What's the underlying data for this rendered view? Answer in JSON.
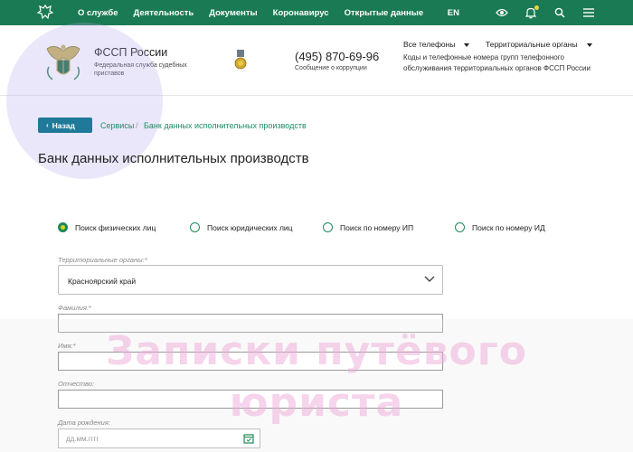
{
  "topnav": {
    "links": [
      "О службе",
      "Деятельность",
      "Документы",
      "Коронавирус",
      "Открытые данные"
    ],
    "lang": "EN",
    "icons": [
      "emblem-icon",
      "eye-icon",
      "bell-icon",
      "search-icon",
      "menu-icon"
    ]
  },
  "header": {
    "brand_title": "ФССП России",
    "brand_sub": "Федеральная служба судебных приставов",
    "phone": "(495) 870-69-96",
    "phone_sub": "Сообщение о коррупции",
    "dropdown_phones": "Все телефоны",
    "dropdown_regions": "Территориальные органы",
    "description": "Коды и телефонные номера групп телефонного обслуживания территориальных органов ФССП России"
  },
  "breadcrumb": {
    "back_label": "Назад",
    "items": [
      "Сервисы",
      "Банк данных исполнительных производств"
    ]
  },
  "page_title": "Банк данных исполнительных производств",
  "search_types": [
    {
      "label": "Поиск физических лиц",
      "checked": true
    },
    {
      "label": "Поиск юридических лиц",
      "checked": false
    },
    {
      "label": "Поиск по номеру ИП",
      "checked": false
    },
    {
      "label": "Поиск по номеру ИД",
      "checked": false
    }
  ],
  "form": {
    "region_label": "Территориальные органы:*",
    "region_value": "Красноярский край",
    "lastname_label": "Фамилия:*",
    "firstname_label": "Имя:*",
    "patronymic_label": "Отчество:",
    "birthdate_label": "Дата рождения:",
    "birthdate_placeholder": "дд.мм.гггг"
  },
  "watermark": {
    "line1": "Записки путёвого",
    "line2": "юриста"
  },
  "colors": {
    "nav_green": "#1a7a53",
    "button_blue": "#1f7a9a",
    "link_green": "#1f8c66",
    "radio_green": "#1d8a58"
  }
}
